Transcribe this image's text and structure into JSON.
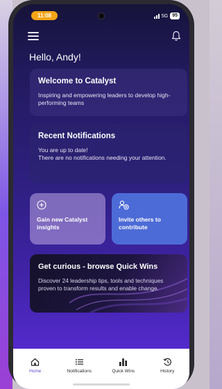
{
  "status_bar": {
    "time": "11:08",
    "network": "5G",
    "battery": "95"
  },
  "header": {
    "greeting": "Hello, Andy!"
  },
  "welcome_card": {
    "title": "Welcome to Catalyst",
    "text": "Inspiring and empowering leaders to develop high-performing teams"
  },
  "notifications_card": {
    "title": "Recent Notifications",
    "line1": "You are up to date!",
    "line2": "There are no notifications needing your attention."
  },
  "tiles": {
    "gain": {
      "label": "Gain new Catalyst insights",
      "icon": "plus-circle-icon"
    },
    "invite": {
      "label": "Invite others to contribute",
      "icon": "invite-users-icon"
    }
  },
  "quick_wins_card": {
    "title": "Get curious - browse Quick Wins",
    "text": "Discover 24 leadership tips, tools and techniques proven to transform results and enable change."
  },
  "bottom_nav": [
    {
      "label": "Home",
      "icon": "home-icon",
      "active": true
    },
    {
      "label": "Notifications",
      "icon": "list-icon",
      "active": false
    },
    {
      "label": "Quick Wins",
      "icon": "bar-chart-icon",
      "active": false
    },
    {
      "label": "History",
      "icon": "history-icon",
      "active": false
    }
  ],
  "colors": {
    "accent": "#5b4bd1",
    "time_pill": "#f2a516",
    "invite_tile": "#4d6bd6"
  }
}
